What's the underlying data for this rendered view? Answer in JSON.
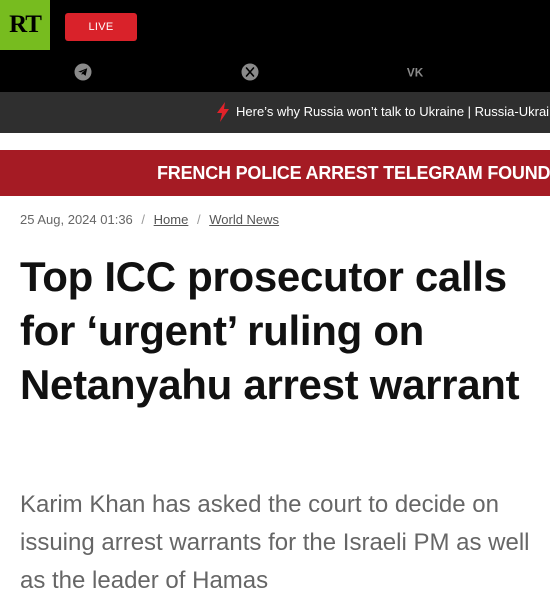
{
  "header": {
    "logo_text": "RT",
    "live_label": "LIVE",
    "social_icons": [
      "telegram-icon",
      "x-icon",
      "vk-icon"
    ],
    "brand_color": "#77bc1f",
    "live_color": "#d9222a"
  },
  "ticker": {
    "text": "Here’s why Russia won’t talk to Ukraine | Russia-Ukraine conflict"
  },
  "banner": {
    "text": "FRENCH POLICE ARREST TELEGRAM FOUNDER",
    "color": "#a51b24"
  },
  "article": {
    "date": "25 Aug, 2024 01:36",
    "breadcrumbs": [
      "Home",
      "World News"
    ],
    "title": "Top ICC prosecutor calls for ‘urgent’ ruling on Netanyahu arrest warrant",
    "summary": "Karim Khan has asked the court to decide on issuing arrest warrants for the Israeli PM as well as the leader of Hamas"
  }
}
